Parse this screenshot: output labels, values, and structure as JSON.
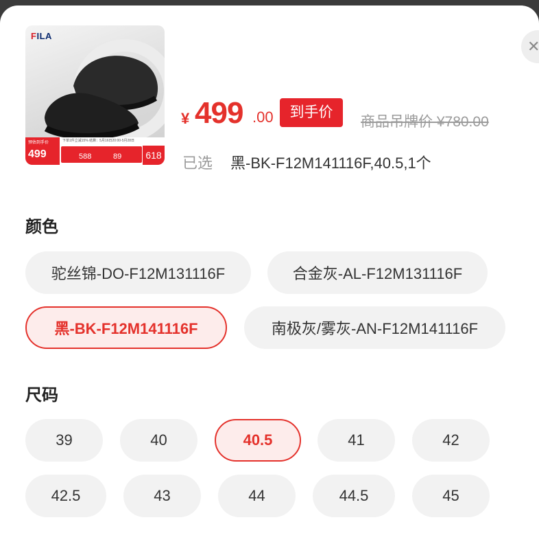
{
  "product": {
    "brand_logo": "FILA",
    "promo": {
      "tag_small": "预估到手价",
      "tag_price": "499",
      "note": "下单1件立减15%   结算：5月16日20:00-5月28日",
      "v1": "588",
      "v2": "89",
      "end": "618"
    }
  },
  "price": {
    "currency": "¥",
    "integer": "499",
    "decimal": ".00",
    "badge": "到手价",
    "original": "商品吊牌价 ¥780.00"
  },
  "selection": {
    "label": "已选",
    "value": "黑-BK-F12M141116F,40.5,1个"
  },
  "color_section": {
    "title": "颜色",
    "options": [
      {
        "label": "驼丝锦-DO-F12M131116F",
        "selected": false
      },
      {
        "label": "合金灰-AL-F12M131116F",
        "selected": false
      },
      {
        "label": "黑-BK-F12M141116F",
        "selected": true
      },
      {
        "label": "南极灰/雾灰-AN-F12M141116F",
        "selected": false
      }
    ]
  },
  "size_section": {
    "title": "尺码",
    "options": [
      {
        "label": "39",
        "selected": false
      },
      {
        "label": "40",
        "selected": false
      },
      {
        "label": "40.5",
        "selected": true
      },
      {
        "label": "41",
        "selected": false
      },
      {
        "label": "42",
        "selected": false
      },
      {
        "label": "42.5",
        "selected": false
      },
      {
        "label": "43",
        "selected": false
      },
      {
        "label": "44",
        "selected": false
      },
      {
        "label": "44.5",
        "selected": false
      },
      {
        "label": "45",
        "selected": false
      }
    ]
  },
  "close_icon": "close-icon",
  "colors": {
    "accent": "#e4312b",
    "chip_bg": "#f2f2f2",
    "selected_bg": "#fdeceb"
  }
}
